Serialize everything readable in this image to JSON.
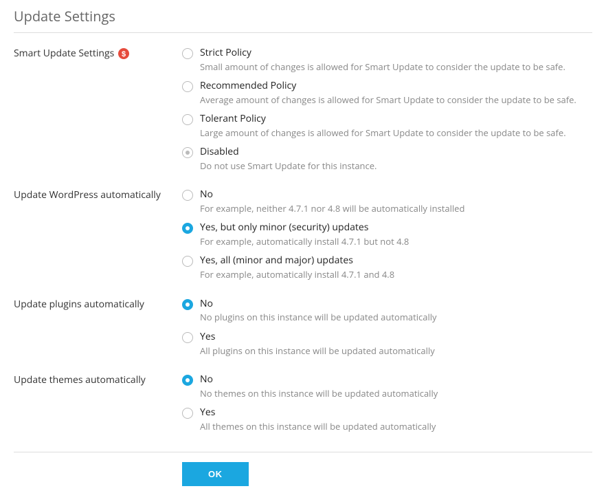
{
  "page": {
    "title": "Update Settings",
    "ok_label": "OK"
  },
  "sections": {
    "smart_update": {
      "label": "Smart Update Settings",
      "badge_icon": "dollar-icon",
      "selected_index": 3,
      "options": [
        {
          "label": "Strict Policy",
          "desc": "Small amount of changes is allowed for Smart Update to consider the update to be safe."
        },
        {
          "label": "Recommended Policy",
          "desc": "Average amount of changes is allowed for Smart Update to consider the update to be safe."
        },
        {
          "label": "Tolerant Policy",
          "desc": "Large amount of changes is allowed for Smart Update to consider the update to be safe."
        },
        {
          "label": "Disabled",
          "desc": "Do not use Smart Update for this instance."
        }
      ]
    },
    "wordpress": {
      "label": "Update WordPress automatically",
      "selected_index": 1,
      "options": [
        {
          "label": "No",
          "desc": "For example, neither 4.7.1 nor 4.8 will be automatically installed"
        },
        {
          "label": "Yes, but only minor (security) updates",
          "desc": "For example, automatically install 4.7.1 but not 4.8"
        },
        {
          "label": "Yes, all (minor and major) updates",
          "desc": "For example, automatically install 4.7.1 and 4.8"
        }
      ]
    },
    "plugins": {
      "label": "Update plugins automatically",
      "selected_index": 0,
      "options": [
        {
          "label": "No",
          "desc": "No plugins on this instance will be updated automatically"
        },
        {
          "label": "Yes",
          "desc": "All plugins on this instance will be updated automatically"
        }
      ]
    },
    "themes": {
      "label": "Update themes automatically",
      "selected_index": 0,
      "options": [
        {
          "label": "No",
          "desc": "No themes on this instance will be updated automatically"
        },
        {
          "label": "Yes",
          "desc": "All themes on this instance will be updated automatically"
        }
      ]
    }
  }
}
